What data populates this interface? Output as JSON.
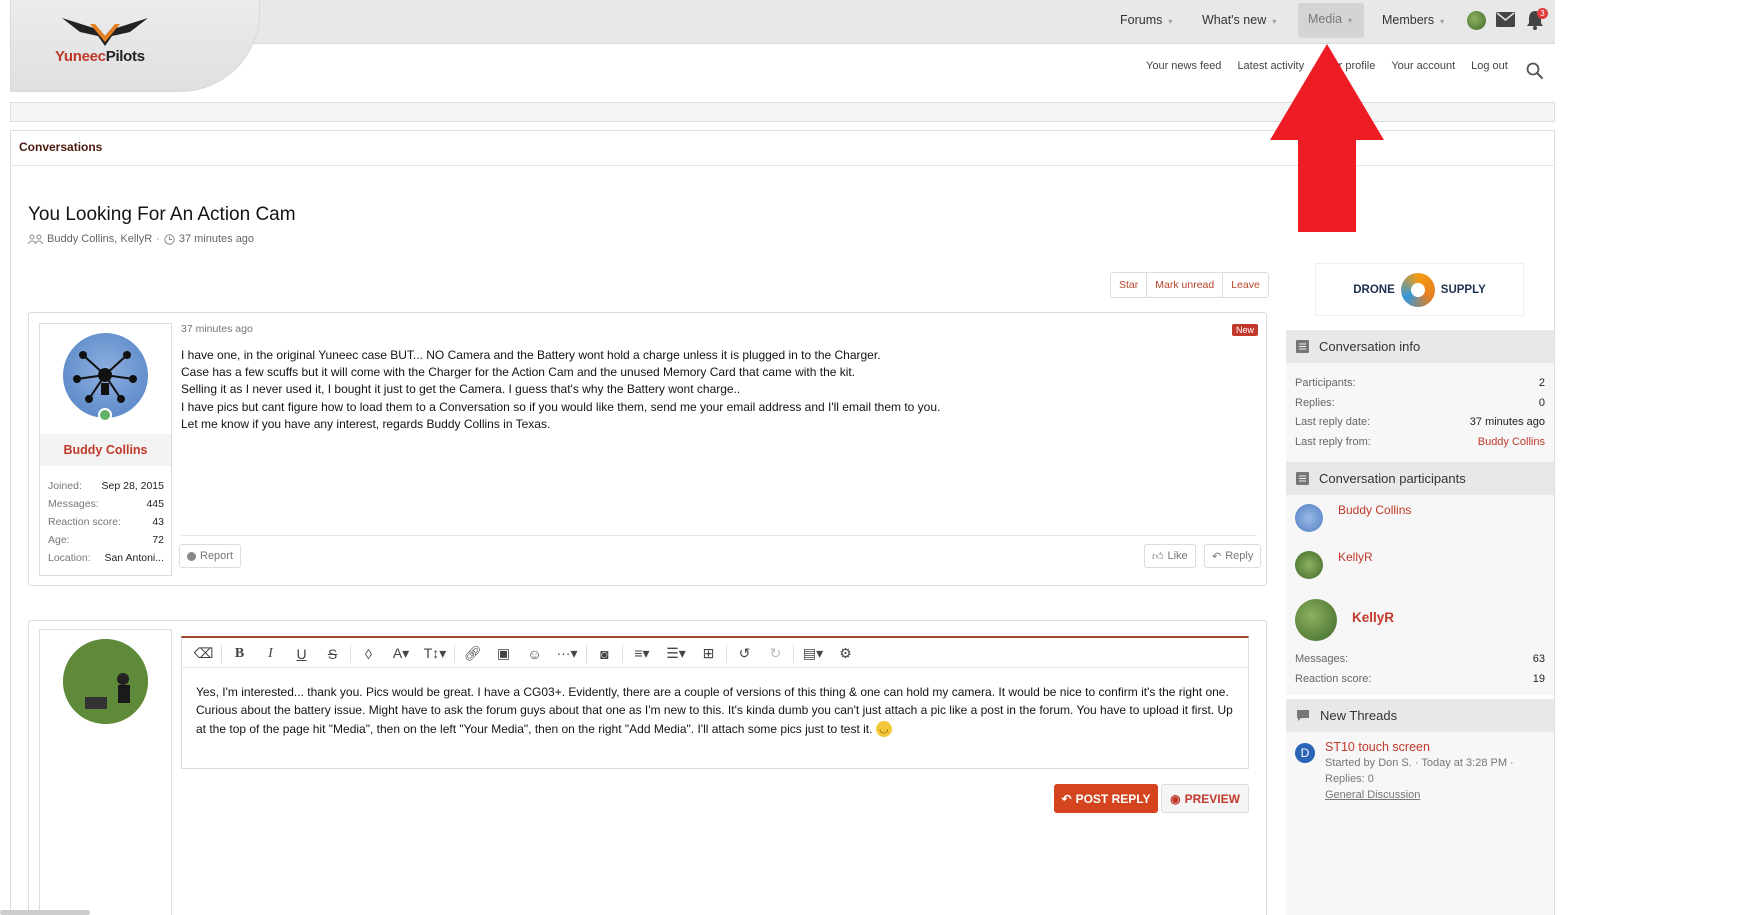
{
  "brand": {
    "name_part1": "Yuneec",
    "name_part2": "Pilots"
  },
  "nav": {
    "forums": "Forums",
    "whats_new": "What's new",
    "media": "Media",
    "members": "Members",
    "alert_count": "3"
  },
  "subnav": [
    "Your news feed",
    "Latest activity",
    "Your profile",
    "Your account",
    "Log out"
  ],
  "breadcrumb": "Conversations",
  "conversation": {
    "title": "You Looking For An Action Cam",
    "participants": "Buddy Collins, KellyR",
    "time": "37 minutes ago"
  },
  "actions": {
    "star": "Star",
    "mark_unread": "Mark unread",
    "leave": "Leave"
  },
  "message": {
    "time": "37 minutes ago",
    "badge": "New",
    "lines": [
      "I have one, in the original Yuneec case BUT... NO Camera and the Battery wont hold a charge unless it is plugged in to the Charger.",
      "Case has a few scuffs but it will come with the Charger for the Action Cam and the unused Memory Card that came with the kit.",
      "Selling it as I never used it, I bought it just to get the Camera. I guess that's why the Battery wont charge..",
      "I have pics but cant figure how to load them to a Conversation so if you would like them, send me your email address and I'll email them to you.",
      "Let me know if you have any interest, regards Buddy Collins in Texas."
    ],
    "report": "Report",
    "like": "Like",
    "reply": "Reply"
  },
  "author": {
    "name": "Buddy Collins",
    "stats": [
      {
        "k": "Joined:",
        "v": "Sep 28, 2015"
      },
      {
        "k": "Messages:",
        "v": "445"
      },
      {
        "k": "Reaction score:",
        "v": "43"
      },
      {
        "k": "Age:",
        "v": "72"
      },
      {
        "k": "Location:",
        "v": "San Antoni..."
      }
    ]
  },
  "editor": {
    "text": "Yes, I'm interested... thank you.  Pics would be great.  I have a CG03+.  Evidently, there are a couple of versions of this thing & one can hold my camera.  It would be nice to confirm it's the right one.  Curious about the battery issue.  Might have to ask the forum guys about that one as I'm new to this.  It's kinda dumb you can't just attach a pic like a post in the forum.  You have to upload it first.  Up at the top of the page hit \"Media\", then on the left \"Your Media\", then on the right \"Add Media\".  I'll attach some pics just to test it.",
    "post_reply": "POST REPLY",
    "preview": "PREVIEW"
  },
  "ad": {
    "left": "DRONE",
    "right": "SUPPLY"
  },
  "sidebar": {
    "info_title": "Conversation info",
    "info": [
      {
        "k": "Participants:",
        "v": "2"
      },
      {
        "k": "Replies:",
        "v": "0"
      },
      {
        "k": "Last reply date:",
        "v": "37 minutes ago"
      },
      {
        "k": "Last reply from:",
        "v": "Buddy Collins"
      }
    ],
    "participants_title": "Conversation participants",
    "participants": [
      "Buddy Collins",
      "KellyR"
    ],
    "featured": {
      "name": "KellyR",
      "messages_k": "Messages:",
      "messages_v": "63",
      "reaction_k": "Reaction score:",
      "reaction_v": "19"
    },
    "new_threads_title": "New Threads",
    "thread": {
      "avatar_letter": "D",
      "title": "ST10 touch screen",
      "meta": "Started by Don S. · Today at 3:28 PM ·",
      "replies": "Replies: 0",
      "forum": "General Discussion"
    }
  },
  "colors": {
    "accent": "#c0392b",
    "button": "#d4441f",
    "arrow": "#ee1c24"
  }
}
